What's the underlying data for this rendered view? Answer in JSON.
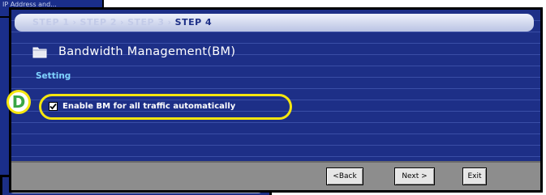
{
  "background": {
    "top_window_text": "IP Address and..."
  },
  "wizard": {
    "steps": [
      "STEP 1",
      "STEP 2",
      "STEP 3",
      "STEP 4"
    ],
    "active_step": "STEP 4",
    "separator": "›",
    "title": "Bandwidth Management(BM)",
    "section_label": "Setting",
    "option": {
      "label": "Enable BM for all traffic automatically",
      "checked": true
    },
    "callout_letter": "D",
    "buttons": {
      "back": "<Back",
      "next": "Next >",
      "exit": "Exit"
    }
  },
  "colors": {
    "window_bg": "#1d2f87",
    "highlight": "#f5e60f",
    "callout_letter": "#3aa645",
    "section_label": "#7fd3ff",
    "button_bar": "#8d8d8d"
  }
}
